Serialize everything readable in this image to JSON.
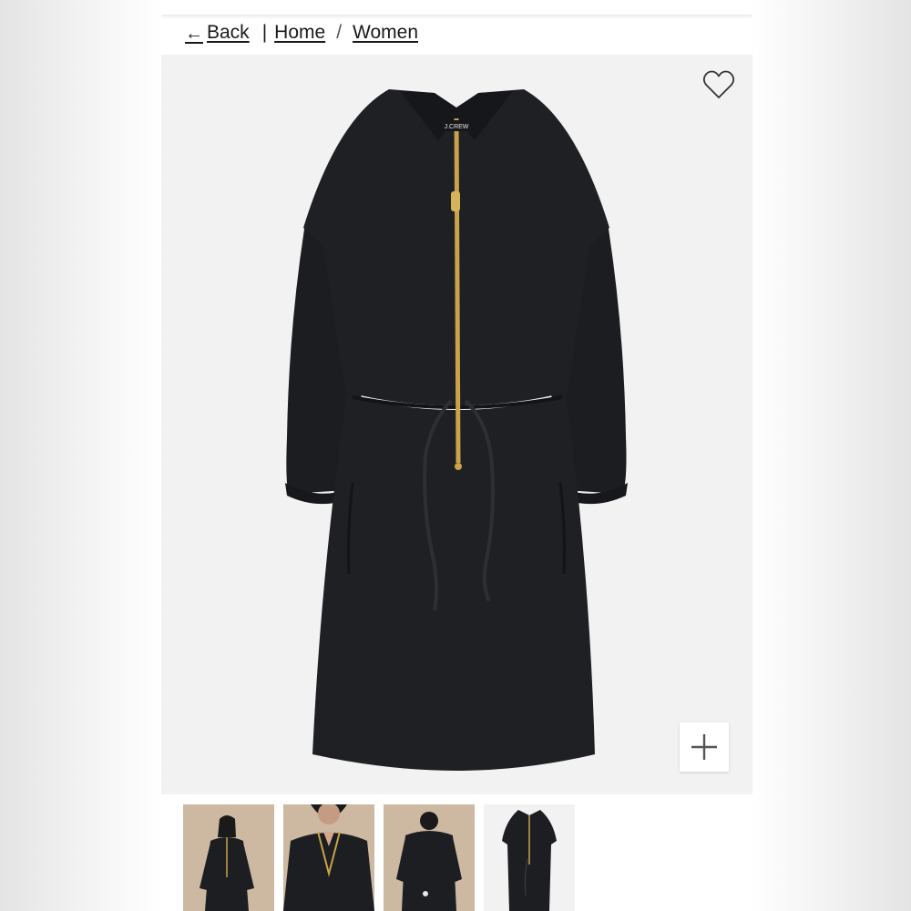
{
  "nav": {
    "back_label": "Back",
    "breadcrumb": [
      "Home",
      "Women"
    ]
  },
  "product": {
    "brand_label": "J.CREW",
    "wishlist_icon": "heart-outline-icon",
    "zoom_icon": "plus-icon"
  },
  "thumbnails": [
    {
      "view": "model-front"
    },
    {
      "view": "model-closeup"
    },
    {
      "view": "model-back"
    },
    {
      "view": "flat-lay"
    }
  ],
  "colors": {
    "hero_background": "#f2f2f2",
    "dress": "#1d1f23",
    "zipper": "#c9a24a",
    "thumb_background": "#cdb9a1"
  }
}
